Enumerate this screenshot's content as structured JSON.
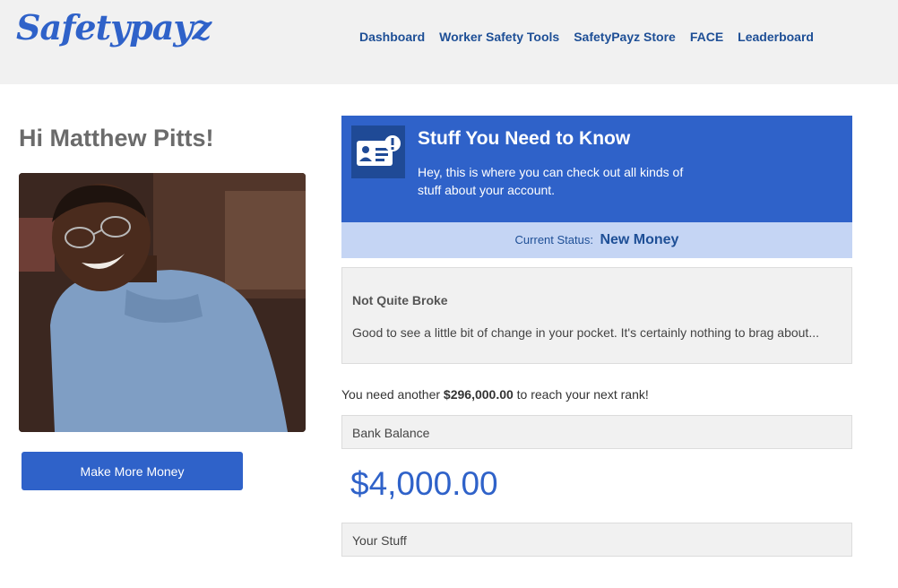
{
  "header": {
    "logo": "Safetypayz",
    "nav": [
      "Dashboard",
      "Worker Safety Tools",
      "SafetyPayz Store",
      "FACE",
      "Leaderboard"
    ]
  },
  "profile": {
    "greeting": "Hi Matthew Pitts!",
    "cta_label": "Make More Money"
  },
  "info": {
    "title": "Stuff You Need to Know",
    "description": "Hey, this is where you can check out all kinds of stuff about your account.",
    "icon": "account-card-alert-icon"
  },
  "status": {
    "label": "Current Status:",
    "value": "New Money"
  },
  "rank": {
    "title": "Not Quite Broke",
    "description": "Good to see a little bit of change in your pocket. It's certainly nothing to brag about..."
  },
  "next_rank": {
    "prefix": "You need another",
    "amount": "$296,000.00",
    "suffix": "to reach your next rank!"
  },
  "bank": {
    "label": "Bank Balance",
    "balance": "$4,000.00"
  },
  "stuff": {
    "label": "Your Stuff"
  },
  "colors": {
    "brand_blue": "#2f62c9",
    "nav_blue": "#1e4f96",
    "status_bg": "#c5d5f4",
    "panel_gray": "#f1f1f1"
  }
}
